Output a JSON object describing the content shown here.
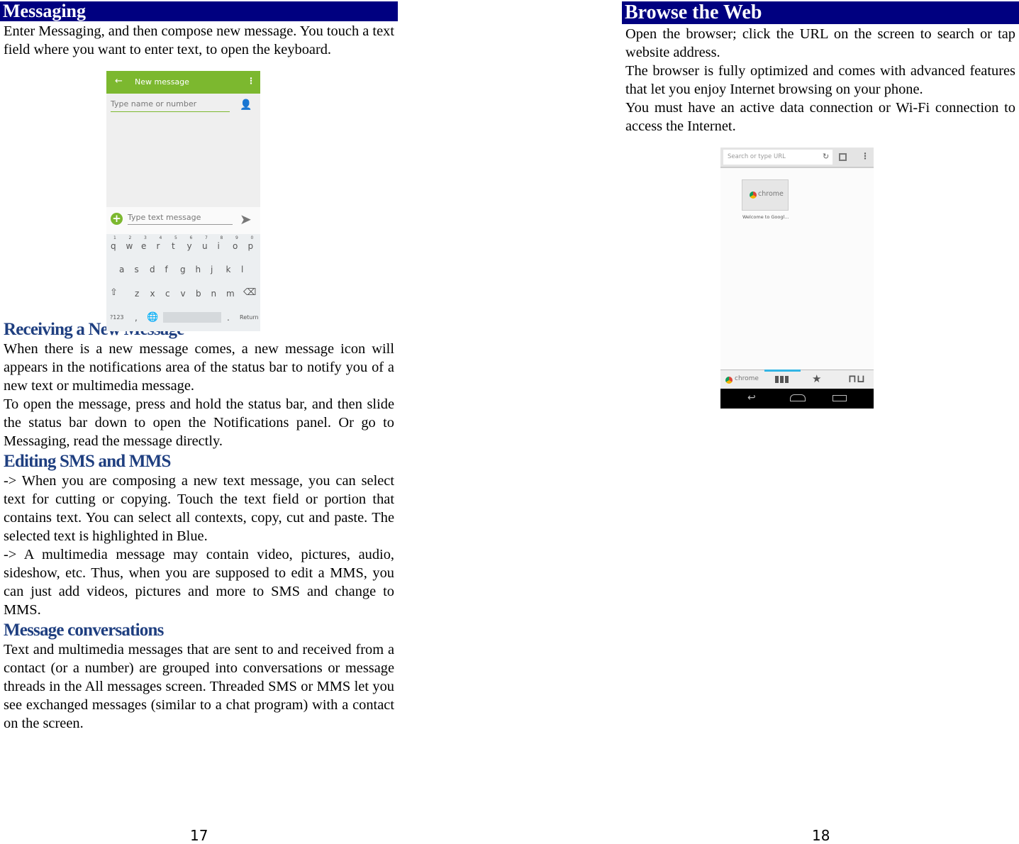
{
  "left_page": {
    "title": "Messaging",
    "intro": "Enter Messaging, and then compose new message. You touch a text field where you want to enter text, to open the keyboard.",
    "sections": [
      {
        "heading": "Receiving a New Message",
        "paragraphs": [
          "When there is a new message comes, a new message icon will appears in the notifications area of the status bar to notify you of a new text or multimedia message.",
          "To open the message, press and hold the status bar, and then slide the status bar down to open the Notifications panel. Or go to Messaging, read the message directly."
        ]
      },
      {
        "heading": "Editing SMS and MMS",
        "paragraphs": [
          "-> When you are composing a new text message, you can select text for cutting or copying. Touch the text field or portion that contains text. You can select all contexts, copy, cut and paste. The selected text is highlighted in Blue.",
          "-> A multimedia message may contain video, pictures, audio, sideshow, etc. Thus, when you are supposed to edit a MMS, you can just add videos, pictures and more to SMS and change to MMS."
        ]
      },
      {
        "heading": "Message conversations",
        "paragraphs": [
          "Text and multimedia messages that are sent to and received from a contact (or a number) are grouped into conversations or message threads in the All messages screen. Threaded SMS or MMS let you see exchanged messages (similar to a chat program) with a contact on the screen."
        ]
      }
    ],
    "page_number": "17",
    "screenshot": {
      "title": "New message",
      "recipient_placeholder": "Type name or number",
      "message_placeholder": "Type text message",
      "keys_row1": [
        "q",
        "w",
        "e",
        "r",
        "t",
        "y",
        "u",
        "i",
        "o",
        "p"
      ],
      "nums_row1": [
        "1",
        "2",
        "3",
        "4",
        "5",
        "6",
        "7",
        "8",
        "9",
        "0"
      ],
      "keys_row2": [
        "a",
        "s",
        "d",
        "f",
        "g",
        "h",
        "j",
        "k",
        "l"
      ],
      "keys_row3": [
        "z",
        "x",
        "c",
        "v",
        "b",
        "n",
        "m"
      ],
      "sym_key": "?123",
      "comma": ",",
      "period": ".",
      "return_key": "Return",
      "accent": "#7cb82f"
    }
  },
  "right_page": {
    "title": "Browse the Web",
    "paragraphs": [
      "Open the browser; click the URL on the screen to search or tap website address.",
      "The browser is fully optimized and comes with advanced features that let you enjoy Internet browsing on your phone.",
      "You must have an active data connection or Wi-Fi connection to access the Internet."
    ],
    "page_number": "18",
    "screenshot": {
      "url_placeholder": "Search or type URL",
      "tile_label": "chrome",
      "tile_caption": "Welcome to Googl...",
      "bottom_tab_label": "chrome",
      "accent": "#33b5e5"
    }
  },
  "colors": {
    "title_bar": "#000080",
    "heading": "#1f3f80"
  }
}
